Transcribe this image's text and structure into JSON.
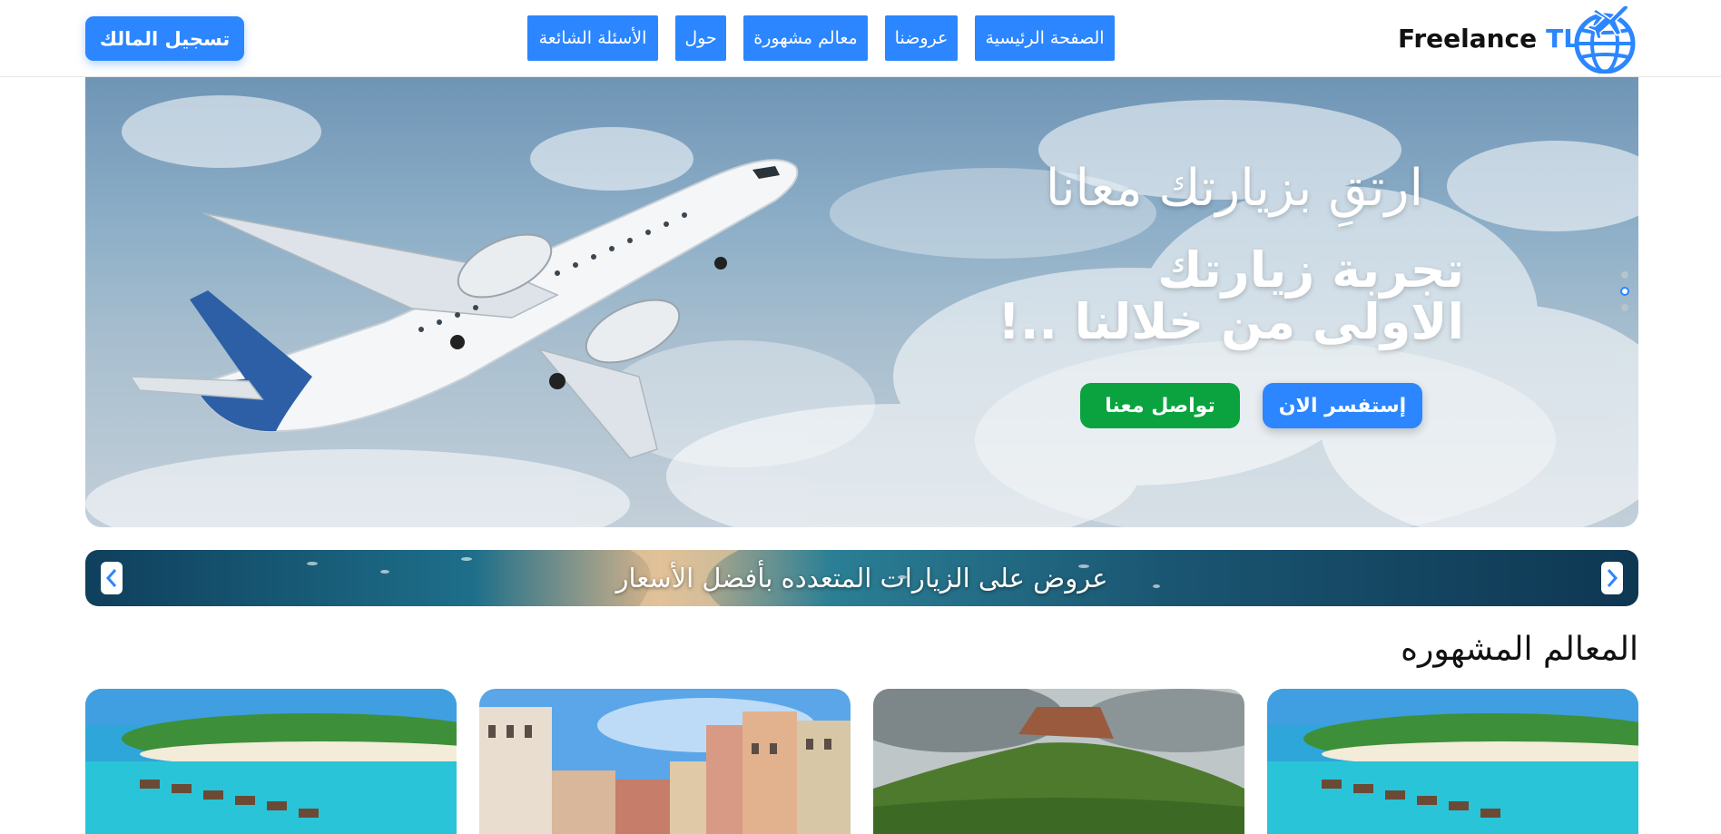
{
  "header": {
    "brand_name": "Freelance",
    "brand_accent": "TL",
    "login_label": "تسجيل المالك",
    "nav": [
      {
        "label": "الصفحة الرئيسية"
      },
      {
        "label": "عروضنا"
      },
      {
        "label": "معالم مشهورة"
      },
      {
        "label": "حول"
      },
      {
        "label": "الأسئلة الشائعة"
      }
    ]
  },
  "hero": {
    "title": "ارتقِ بزيارتك معانا",
    "subtitle": "تجربة زيارتك الاولى من خلالنا ..!",
    "inquire_label": "إستفسر الان",
    "contact_label": "تواصل معنا",
    "slide_count": 3,
    "active_slide": 2
  },
  "offers": {
    "text": "عروض على الزيارات المتعدده بأفضل الأسعار",
    "prev_icon": "chevron-left-icon",
    "next_icon": "chevron-right-icon"
  },
  "landmarks": {
    "title": "المعالم المشهوره",
    "cards": [
      {
        "image": "maldives-beach-image"
      },
      {
        "image": "venice-canal-image"
      },
      {
        "image": "sigiriya-rock-image"
      },
      {
        "image": "maldives-beach-image"
      }
    ]
  },
  "colors": {
    "primary": "#2b86ff",
    "success": "#0aa33f"
  }
}
